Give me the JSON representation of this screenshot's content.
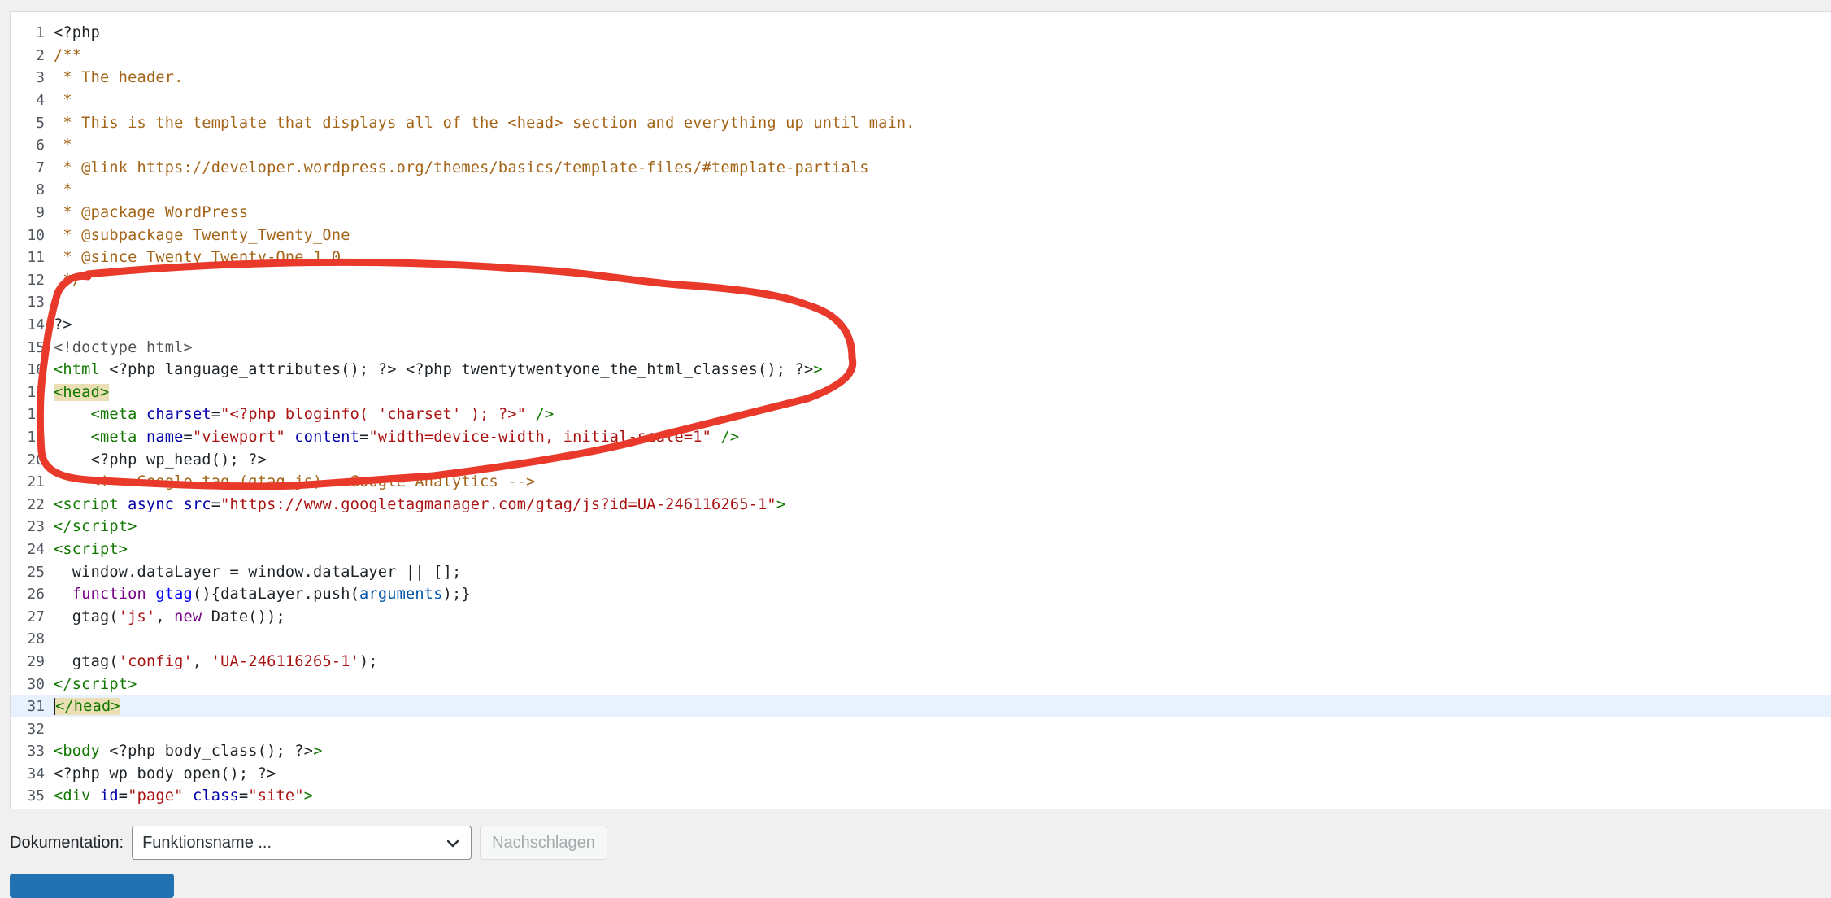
{
  "editor": {
    "lines": [
      {
        "n": "1",
        "html": "&lt;?php"
      },
      {
        "n": "2",
        "html": "<span class='c-comment'>/**</span>"
      },
      {
        "n": "3",
        "html": "<span class='c-comment'> * The header.</span>"
      },
      {
        "n": "4",
        "html": "<span class='c-comment'> *</span>"
      },
      {
        "n": "5",
        "html": "<span class='c-comment'> * This is the template that displays all of the &lt;head&gt; section and everything up until main.</span>"
      },
      {
        "n": "6",
        "html": "<span class='c-comment'> *</span>"
      },
      {
        "n": "7",
        "html": "<span class='c-comment'> * @link https://developer.wordpress.org/themes/basics/template-files/#template-partials</span>"
      },
      {
        "n": "8",
        "html": "<span class='c-comment'> *</span>"
      },
      {
        "n": "9",
        "html": "<span class='c-comment'> * @package WordPress</span>"
      },
      {
        "n": "10",
        "html": "<span class='c-comment'> * @subpackage Twenty_Twenty_One</span>"
      },
      {
        "n": "11",
        "html": "<span class='c-comment'> * @since Twenty Twenty-One 1.0</span>"
      },
      {
        "n": "12",
        "html": "<span class='c-comment'> */</span>"
      },
      {
        "n": "13",
        "html": ""
      },
      {
        "n": "14",
        "html": "?&gt;"
      },
      {
        "n": "15",
        "html": "<span class='c-meta'>&lt;!doctype html&gt;</span>"
      },
      {
        "n": "16",
        "html": "<span class='c-tag'>&lt;html</span> &lt;?php language_attributes(); ?&gt; &lt;?php twentytwentyone_the_html_classes(); ?&gt;<span class='c-tag'>&gt;</span>"
      },
      {
        "n": "17",
        "html": "<span class='c-hl'>&lt;head&gt;</span>"
      },
      {
        "n": "18",
        "html": "    <span class='c-tag'>&lt;meta</span> <span class='c-attr'>charset</span>=<span class='c-str'>\"&lt;?php bloginfo( 'charset' ); ?&gt;\"</span> <span class='c-tag'>/&gt;</span>"
      },
      {
        "n": "19",
        "html": "    <span class='c-tag'>&lt;meta</span> <span class='c-attr'>name</span>=<span class='c-str'>\"viewport\"</span> <span class='c-attr'>content</span>=<span class='c-str'>\"width=device-width, initial-scale=1\"</span> <span class='c-tag'>/&gt;</span>"
      },
      {
        "n": "20",
        "html": "    &lt;?php wp_head(); ?&gt;"
      },
      {
        "n": "21",
        "html": "    <span class='c-comment'>&lt;!-- Google tag (gtag.js) - Google Analytics --&gt;</span>"
      },
      {
        "n": "22",
        "html": "<span class='c-tag'>&lt;script</span> <span class='c-attr'>async</span> <span class='c-attr'>src</span>=<span class='c-str'>\"https://www.googletagmanager.com/gtag/js?id=UA-246116265-1\"</span><span class='c-tag'>&gt;</span>"
      },
      {
        "n": "23",
        "html": "<span class='c-tag'>&lt;/script&gt;</span>"
      },
      {
        "n": "24",
        "html": "<span class='c-tag'>&lt;script&gt;</span>"
      },
      {
        "n": "25",
        "html": "  window.dataLayer = window.dataLayer || [];"
      },
      {
        "n": "26",
        "html": "  <span class='c-kw'>function</span> <span class='c-def'>gtag</span>(){dataLayer.push(<span class='c-var2'>arguments</span>);}"
      },
      {
        "n": "27",
        "html": "  gtag(<span class='c-str'>'js'</span>, <span class='c-kw'>new</span> Date());"
      },
      {
        "n": "28",
        "html": ""
      },
      {
        "n": "29",
        "html": "  gtag(<span class='c-str'>'config'</span>, <span class='c-str'>'UA-246116265-1'</span>);"
      },
      {
        "n": "30",
        "html": "<span class='c-tag'>&lt;/script&gt;</span>"
      },
      {
        "n": "31",
        "html": "<span class='cursor'></span><span class='c-hl'>&lt;/head&gt;</span>",
        "active": true
      },
      {
        "n": "32",
        "html": ""
      },
      {
        "n": "33",
        "html": "<span class='c-tag'>&lt;body</span> &lt;?php body_class(); ?&gt;<span class='c-tag'>&gt;</span>"
      },
      {
        "n": "34",
        "html": "&lt;?php wp_body_open(); ?&gt;"
      },
      {
        "n": "35",
        "html": "<span class='c-tag'>&lt;div</span> <span class='c-attr'>id</span>=<span class='c-str'>\"page\"</span> <span class='c-attr'>class</span>=<span class='c-str'>\"site\"</span><span class='c-tag'>&gt;</span>"
      }
    ]
  },
  "docs": {
    "label": "Dokumentation:",
    "select_value": "Funktionsname ...",
    "lookup_button": "Nachschlagen"
  },
  "colors": {
    "annotation": "#e8392a",
    "accent": "#2271b1"
  }
}
